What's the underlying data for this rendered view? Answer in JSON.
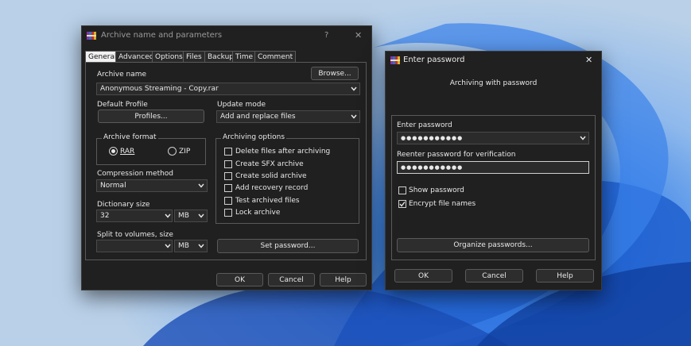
{
  "archive_dialog": {
    "title": "Archive name and parameters",
    "help_glyph": "?",
    "close_glyph": "✕",
    "tabs": [
      "General",
      "Advanced",
      "Options",
      "Files",
      "Backup",
      "Time",
      "Comment"
    ],
    "archive_name_label": "Archive name",
    "browse_label": "Browse...",
    "archive_name_value": "Anonymous Streaming - Copy.rar",
    "default_profile_label": "Default Profile",
    "profiles_label": "Profiles...",
    "update_mode_label": "Update mode",
    "update_mode_value": "Add and replace files",
    "archive_format_label": "Archive format",
    "format_rar": "RAR",
    "format_zip": "ZIP",
    "archiving_options_label": "Archiving options",
    "options": [
      {
        "label": "Delete files after archiving",
        "checked": false
      },
      {
        "label": "Create SFX archive",
        "checked": false
      },
      {
        "label": "Create solid archive",
        "checked": false
      },
      {
        "label": "Add recovery record",
        "checked": false
      },
      {
        "label": "Test archived files",
        "checked": false
      },
      {
        "label": "Lock archive",
        "checked": false
      }
    ],
    "compression_label": "Compression method",
    "compression_value": "Normal",
    "dictionary_label": "Dictionary size",
    "dictionary_value": "32",
    "dictionary_unit": "MB",
    "split_label": "Split to volumes, size",
    "split_value": "",
    "split_unit": "MB",
    "set_password_label": "Set password...",
    "ok_label": "OK",
    "cancel_label": "Cancel",
    "help_label": "Help"
  },
  "password_dialog": {
    "title": "Enter password",
    "close_glyph": "✕",
    "heading": "Archiving with password",
    "enter_label": "Enter password",
    "enter_value": "●●●●●●●●●●●",
    "reenter_label": "Reenter password for verification",
    "reenter_value": "●●●●●●●●●●●",
    "show_password_label": "Show password",
    "show_password_checked": false,
    "encrypt_names_label": "Encrypt file names",
    "encrypt_names_checked": true,
    "organize_label": "Organize passwords...",
    "ok_label": "OK",
    "cancel_label": "Cancel",
    "help_label": "Help"
  },
  "icons": {
    "app": "winrar-books-icon",
    "dropdown": "chevron-down-icon"
  },
  "colors": {
    "dialog_bg": "#202020",
    "field_bg": "#2b2b2b",
    "desktop_blue": "#2d6fd6"
  }
}
